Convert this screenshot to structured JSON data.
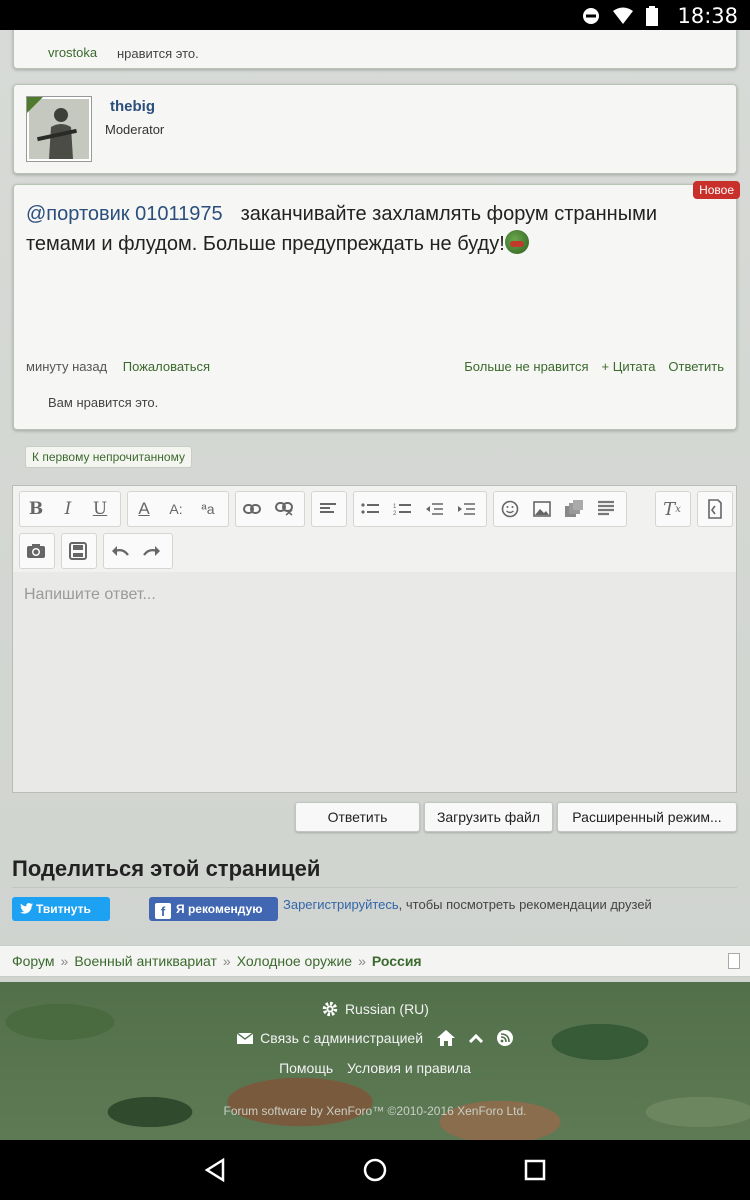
{
  "statusbar": {
    "time": "18:38"
  },
  "previous_post": {
    "liker": "vrostoka",
    "likes_text": "нравится это."
  },
  "author": {
    "name": "thebig",
    "role": "Moderator"
  },
  "post": {
    "badge": "Новое",
    "mention": "@портовик 01011975",
    "message": "заканчивайте захламлять форум странными темами и флудом. Больше предупреждать не буду!",
    "time": "минуту назад",
    "report": "Пожаловаться",
    "unlike": "Больше не нравится",
    "quote": "+ Цитата",
    "reply": "Ответить",
    "likes_text": "Вам нравится это."
  },
  "first_unread": "К первому непрочитанному",
  "editor": {
    "placeholder": "Напишите ответ..."
  },
  "buttons": {
    "reply": "Ответить",
    "upload": "Загрузить файл",
    "advanced": "Расширенный режим..."
  },
  "share": {
    "title": "Поделиться этой страницей",
    "tweet": "Твитнуть",
    "fb_like": "Я рекомендую",
    "register": "Зарегистрируйтесь",
    "register_rest": ", чтобы посмотреть рекомендации друзей"
  },
  "breadcrumb": [
    "Форум",
    "Военный антиквариат",
    "Холодное оружие",
    "Россия"
  ],
  "footer": {
    "language": "Russian (RU)",
    "contact": "Связь с администрацией",
    "help": "Помощь",
    "terms": "Условия и правила",
    "copyright": "Forum software by XenForo™ ©2010-2016 XenForo Ltd."
  }
}
